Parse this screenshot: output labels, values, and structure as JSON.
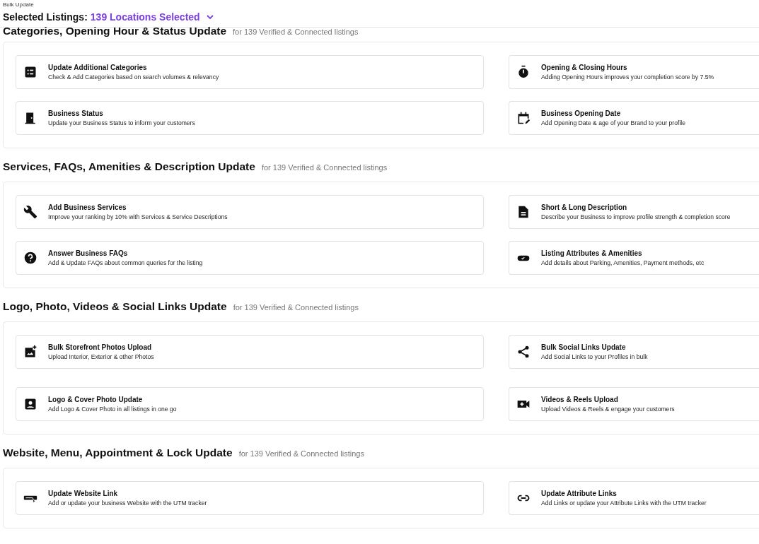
{
  "breadcrumb": "Bulk Update",
  "selection": {
    "label": "Selected Listings:",
    "value": "139 Locations Selected"
  },
  "sections": [
    {
      "title": "Categories, Opening Hour & Status Update",
      "subtitle": "for 139 Verified & Connected listings",
      "cards": [
        {
          "title": "Update Additional Categories",
          "description": "Check & Add Categories based on search volumes & relevancy"
        },
        {
          "title": "Opening & Closing Hours",
          "description": "Adding Opening Hours improves your completion score by 7.5%"
        },
        {
          "title": "Business Status",
          "description": "Update your Business Status to inform your customers"
        },
        {
          "title": "Business Opening Date",
          "description": "Add Opening Date & age of your Brand to your profile"
        }
      ]
    },
    {
      "title": "Services, FAQs, Amenities & Description Update",
      "subtitle": "for 139 Verified & Connected listings",
      "cards": [
        {
          "title": "Add Business Services",
          "description": "Improve your ranking by 10% with Services & Service Descriptions"
        },
        {
          "title": "Short & Long Description",
          "description": "Describe your Business to improve profile strength & completion score"
        },
        {
          "title": "Answer Business FAQs",
          "description": "Add & Update FAQs about common queries for the listing"
        },
        {
          "title": "Listing Attributes & Amenities",
          "description": "Add details about Parking, Amenities, Payment methods, etc"
        }
      ]
    },
    {
      "title": "Logo, Photo, Videos & Social Links Update",
      "subtitle": "for 139 Verified & Connected listings",
      "cards": [
        {
          "title": "Bulk Storefront Photos Upload",
          "description": "Upload Interior, Exterior & other Photos"
        },
        {
          "title": "Bulk Social Links Update",
          "description": "Add Social Links to your Profiles in bulk"
        },
        {
          "title": "Logo & Cover Photo Update",
          "description": "Add Logo & Cover Photo in all listings in one go"
        },
        {
          "title": "Videos & Reels Upload",
          "description": "Upload Videos & Reels & engage your customers"
        }
      ]
    },
    {
      "title": "Website, Menu, Appointment & Lock Update",
      "subtitle": "for 139 Verified & Connected listings",
      "cards": [
        {
          "title": "Update Website Link",
          "description": "Add or update your business Website with the UTM tracker"
        },
        {
          "title": "Update Attribute Links",
          "description": "Add Links or update your Attribute Links with the UTM tracker"
        }
      ]
    }
  ]
}
